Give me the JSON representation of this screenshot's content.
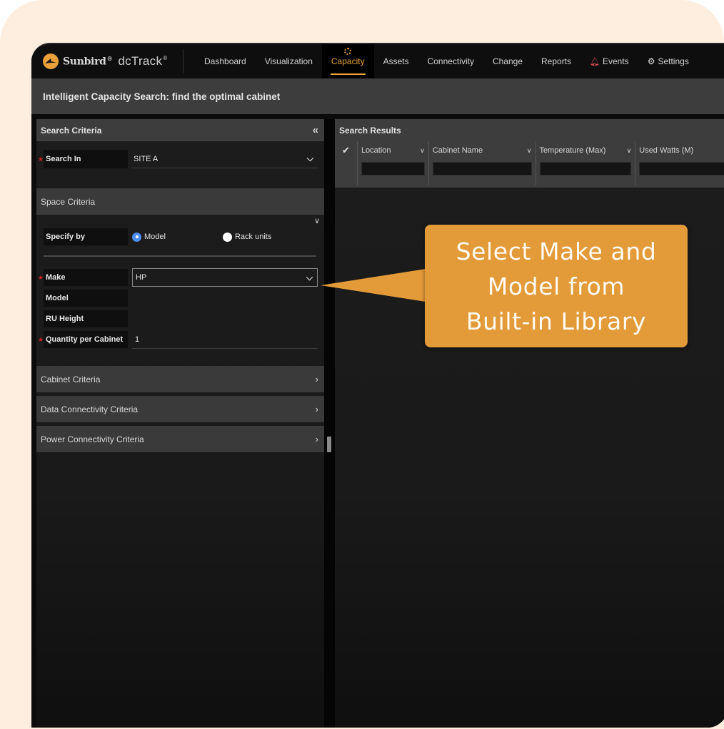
{
  "brand": {
    "company": "Sunbird",
    "product": "dcTrack",
    "registered_mark": "®",
    "logo_color": "#e9a03b"
  },
  "nav": {
    "items": [
      {
        "label": "Dashboard",
        "active": false
      },
      {
        "label": "Visualization",
        "active": false
      },
      {
        "label": "Capacity",
        "active": true
      },
      {
        "label": "Assets",
        "active": false
      },
      {
        "label": "Connectivity",
        "active": false
      },
      {
        "label": "Change",
        "active": false
      },
      {
        "label": "Reports",
        "active": false
      },
      {
        "label": "Events",
        "active": false,
        "icon": "bell-icon"
      },
      {
        "label": "Settings",
        "active": false,
        "icon": "gear-icon"
      }
    ],
    "accent_color": "#e8a23a"
  },
  "page": {
    "title": "Intelligent Capacity Search: find the optimal cabinet"
  },
  "search_criteria": {
    "title": "Search Criteria",
    "collapse_icon": "double-chevron-left-icon",
    "search_in": {
      "label": "Search In",
      "required": true,
      "value": "SITE A"
    },
    "space_criteria": {
      "title": "Space Criteria",
      "specify_by": {
        "label": "Specify by",
        "options": [
          {
            "label": "Model",
            "checked": true
          },
          {
            "label": "Rack units",
            "checked": false
          }
        ]
      },
      "make": {
        "label": "Make",
        "required": true,
        "value": "HP"
      },
      "model": {
        "label": "Model",
        "value": ""
      },
      "ru_height": {
        "label": "RU Height",
        "value": ""
      },
      "quantity": {
        "label": "Quantity per Cabinet",
        "required": true,
        "value": "1"
      }
    },
    "sections": [
      {
        "label": "Cabinet Criteria"
      },
      {
        "label": "Data Connectivity Criteria"
      },
      {
        "label": "Power Connectivity Criteria"
      }
    ]
  },
  "search_results": {
    "title": "Search Results",
    "columns": [
      {
        "label": "Location"
      },
      {
        "label": "Cabinet Name"
      },
      {
        "label": "Temperature (Max)"
      },
      {
        "label": "Used Watts (M)"
      }
    ],
    "rows": []
  },
  "callout": {
    "lines": [
      "Select Make and",
      "Model from",
      "Built-in Library"
    ],
    "color": "#e39a39"
  }
}
